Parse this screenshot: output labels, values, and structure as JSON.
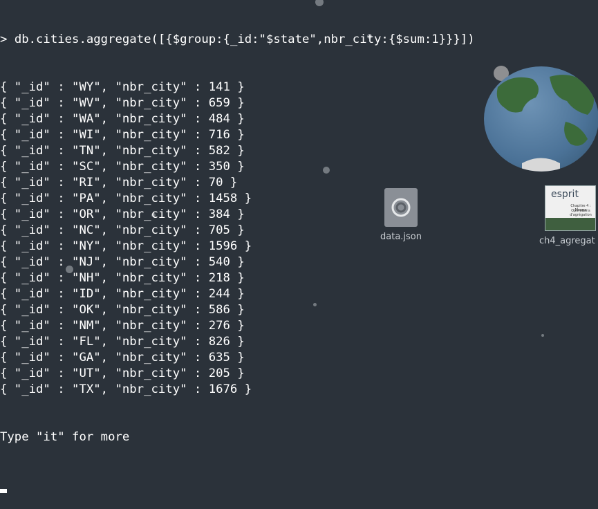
{
  "terminal": {
    "prompt": "> ",
    "command": "db.cities.aggregate([{$group:{_id:\"$state\",nbr_city:{$sum:1}}}])",
    "results": [
      {
        "id": "WY",
        "nbr_city": 141
      },
      {
        "id": "WV",
        "nbr_city": 659
      },
      {
        "id": "WA",
        "nbr_city": 484
      },
      {
        "id": "WI",
        "nbr_city": 716
      },
      {
        "id": "TN",
        "nbr_city": 582
      },
      {
        "id": "SC",
        "nbr_city": 350
      },
      {
        "id": "RI",
        "nbr_city": 70
      },
      {
        "id": "PA",
        "nbr_city": 1458
      },
      {
        "id": "OR",
        "nbr_city": 384
      },
      {
        "id": "NC",
        "nbr_city": 705
      },
      {
        "id": "NY",
        "nbr_city": 1596
      },
      {
        "id": "NJ",
        "nbr_city": 540
      },
      {
        "id": "NH",
        "nbr_city": 218
      },
      {
        "id": "ID",
        "nbr_city": 244
      },
      {
        "id": "OK",
        "nbr_city": 586
      },
      {
        "id": "NM",
        "nbr_city": 276
      },
      {
        "id": "FL",
        "nbr_city": 826
      },
      {
        "id": "GA",
        "nbr_city": 635
      },
      {
        "id": "UT",
        "nbr_city": 205
      },
      {
        "id": "TX",
        "nbr_city": 1676
      }
    ],
    "more_hint": "Type \"it\" for more"
  },
  "desktop": {
    "icons": [
      {
        "label": "data.json",
        "icon": "json-file-icon"
      },
      {
        "label": "ch4_agregat",
        "icon": "pdf-document-icon",
        "thumb_logo": "esprit",
        "thumb_line1": "Chapitre 4 : Mongo",
        "thumb_line2": "Opérations d'agrégation"
      }
    ]
  },
  "colors": {
    "background": "#2b323a",
    "text": "#ffffff",
    "icon_label": "#c9ced3"
  }
}
